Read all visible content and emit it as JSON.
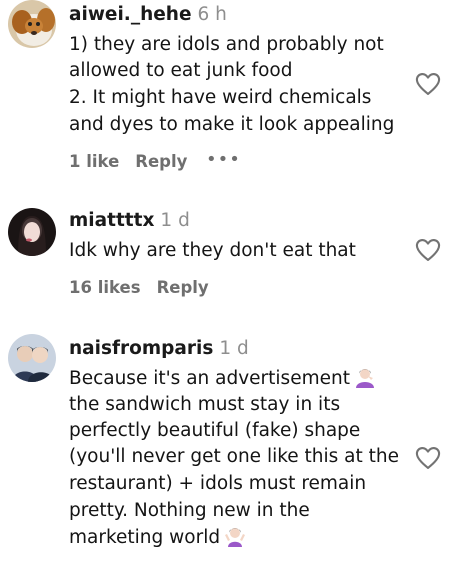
{
  "comments": [
    {
      "username": "aiwei._hehe",
      "time": "6 h",
      "lines": [
        "1) they are idols and probably not",
        "allowed to eat junk food",
        "2. It might have weird chemicals",
        "and dyes to make it look appealing"
      ],
      "likes": "1 like",
      "reply": "Reply",
      "more": "•••",
      "avatar_icon": "dog-avatar"
    },
    {
      "username": "miattttx",
      "time": "1 d",
      "lines": [
        "Idk why are they don't eat that"
      ],
      "likes": "16 likes",
      "reply": "Reply",
      "avatar_icon": "person-avatar"
    },
    {
      "username": "naisfromparis",
      "time": "1 d",
      "lines": [
        "Because it's an advertisement",
        "the sandwich must stay in its",
        "perfectly beautiful (fake) shape",
        "(you'll never get one like this at the",
        "restaurant) + idols must remain",
        "pretty. Nothing new in the",
        "marketing world"
      ],
      "avatar_icon": "two-people-avatar",
      "emojis": [
        "person-facepalming-emoji",
        "person-shrugging-emoji"
      ]
    }
  ],
  "colors": {
    "text": "#141414",
    "muted": "#6f6f6f",
    "time": "#8e8e8e",
    "heart": "#737373"
  }
}
